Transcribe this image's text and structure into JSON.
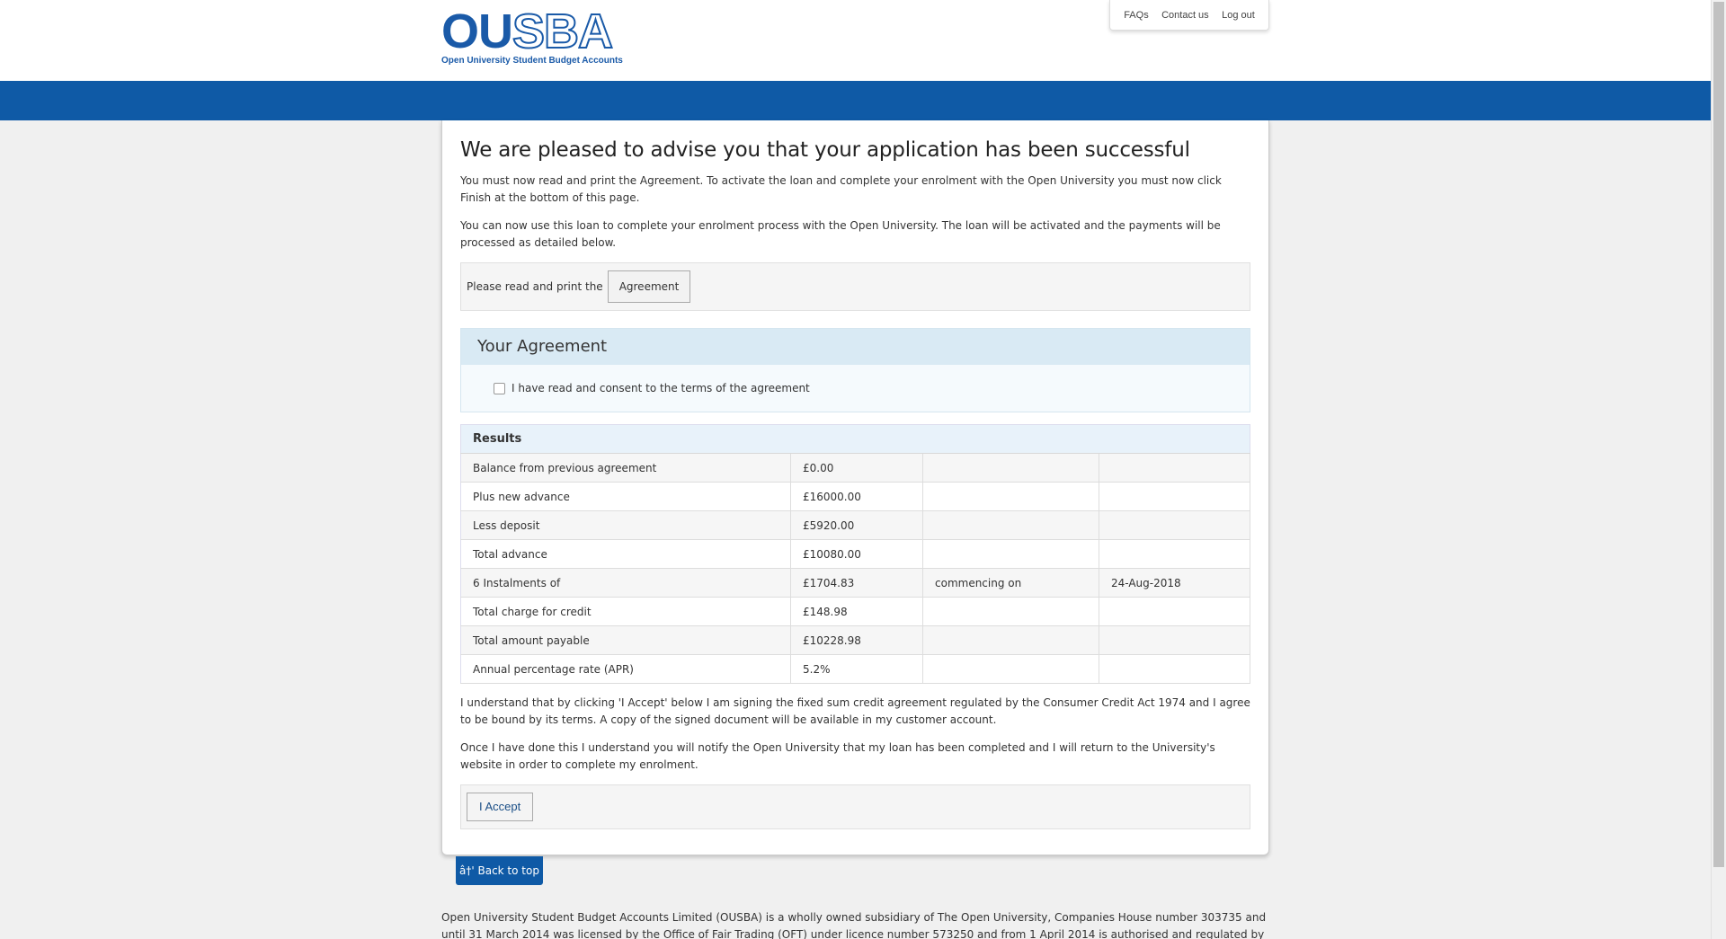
{
  "header": {
    "logo_text_solid": "OU",
    "logo_text_outline": "SBA",
    "logo_subtitle": "Open University Student Budget Accounts",
    "nav": [
      "FAQs",
      "Contact us",
      "Log out"
    ]
  },
  "main": {
    "title": "We are pleased to advise you that your application has been successful",
    "para1": "You must now read and print the Agreement. To activate the loan and complete your enrolment with the Open University you must now click Finish at the bottom of this page.",
    "para2": "You can now use this loan to complete your enrolment process with the Open University. The loan will be activated and the payments will be processed as detailed below.",
    "print_label": "Please read and print the",
    "agreement_button": "Agreement",
    "agreement_panel_title": "Your Agreement",
    "consent_label": "I have read and consent to the terms of the agreement",
    "results_header": "Results",
    "results_rows": [
      [
        "Balance from previous agreement",
        "£0.00",
        "",
        ""
      ],
      [
        "Plus new advance",
        "£16000.00",
        "",
        ""
      ],
      [
        "Less deposit",
        "£5920.00",
        "",
        ""
      ],
      [
        "Total advance",
        "£10080.00",
        "",
        ""
      ],
      [
        "6 Instalments of",
        "£1704.83",
        "commencing on",
        "24-Aug-2018"
      ],
      [
        "Total charge for credit",
        "£148.98",
        "",
        ""
      ],
      [
        "Total amount payable",
        "£10228.98",
        "",
        ""
      ],
      [
        "Annual percentage rate (APR)",
        "5.2%",
        "",
        ""
      ]
    ],
    "para3": "I understand that by clicking 'I Accept' below I am signing the fixed sum credit agreement regulated by the Consumer Credit Act 1974 and I agree to be bound by its terms. A copy of the signed document will be available in my customer account.",
    "para4": "Once I have done this I understand you will notify the Open University that my loan has been completed and I will return to the University's website in order to complete my enrolment.",
    "accept_button": "I Accept"
  },
  "back_to_top": "â†' Back to top",
  "footer_text": "Open University Student Budget Accounts Limited (OUSBA) is a wholly owned subsidiary of The Open University, Companies House number 303735 and until 31 March 2014 was licensed by the Office of Fair Trading (OFT) under licence number 573250 and from 1 April 2014 is authorised and regulated by the Financial",
  "colors": {
    "brand_blue": "#0f5aa6",
    "panel_header": "#d9eaf4"
  }
}
